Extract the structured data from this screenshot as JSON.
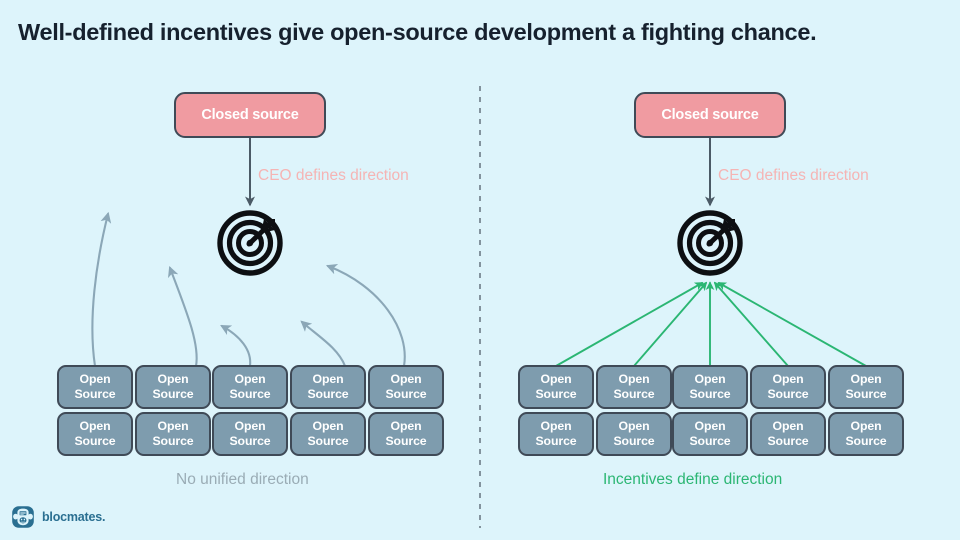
{
  "page": {
    "title": "Well-defined incentives give open-source development a fighting chance.",
    "background_color": "#ddf4fb"
  },
  "colors": {
    "background": "#ddf4fb",
    "closed_source_fill": "#f09ba1",
    "open_source_fill": "#7e9cae",
    "node_border": "#3f4a57",
    "chaotic_arrow": "#7e9cae",
    "aligned_arrow": "#2bb673",
    "edge_label_text": "#f5b4b4",
    "caption_left_text": "#9aacb5",
    "caption_right_text": "#2bb673",
    "title_text": "#16212e",
    "divider": "#6d7b86",
    "logo_text": "#2a6f91"
  },
  "panels": [
    {
      "id": "left",
      "closed_source_label": "Closed source",
      "edge_label": "CEO defines direction",
      "target_icon": "target-bullseye-icon",
      "caption": "No unified direction",
      "open_source_rows": [
        [
          {
            "line1": "Open",
            "line2": "Source"
          },
          {
            "line1": "Open",
            "line2": "Source"
          },
          {
            "line1": "Open",
            "line2": "Source"
          },
          {
            "line1": "Open",
            "line2": "Source"
          },
          {
            "line1": "Open",
            "line2": "Source"
          }
        ],
        [
          {
            "line1": "Open",
            "line2": "Source"
          },
          {
            "line1": "Open",
            "line2": "Source"
          },
          {
            "line1": "Open",
            "line2": "Source"
          },
          {
            "line1": "Open",
            "line2": "Source"
          },
          {
            "line1": "Open",
            "line2": "Source"
          }
        ]
      ]
    },
    {
      "id": "right",
      "closed_source_label": "Closed source",
      "edge_label": "CEO defines direction",
      "target_icon": "target-bullseye-icon",
      "caption": "Incentives define direction",
      "open_source_rows": [
        [
          {
            "line1": "Open",
            "line2": "Source"
          },
          {
            "line1": "Open",
            "line2": "Source"
          },
          {
            "line1": "Open",
            "line2": "Source"
          },
          {
            "line1": "Open",
            "line2": "Source"
          },
          {
            "line1": "Open",
            "line2": "Source"
          }
        ],
        [
          {
            "line1": "Open",
            "line2": "Source"
          },
          {
            "line1": "Open",
            "line2": "Source"
          },
          {
            "line1": "Open",
            "line2": "Source"
          },
          {
            "line1": "Open",
            "line2": "Source"
          },
          {
            "line1": "Open",
            "line2": "Source"
          }
        ]
      ]
    }
  ],
  "divider": {
    "icon": "vertical-dashed-divider"
  },
  "logo": {
    "mark": "blocmates-ape-logo-icon",
    "text": "blocmates."
  }
}
